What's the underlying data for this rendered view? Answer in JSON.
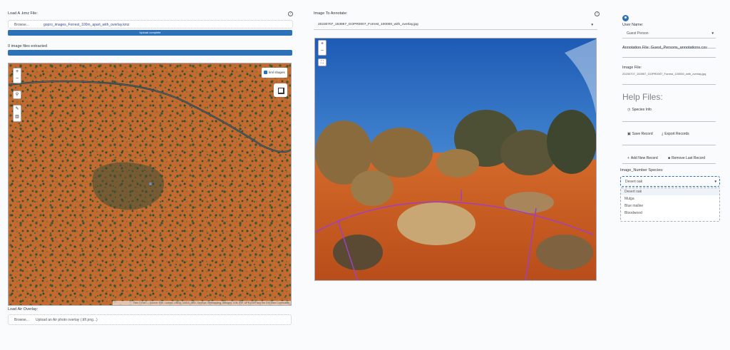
{
  "left": {
    "kmz_label": "Load A .kmz File:",
    "browse": "Browse...",
    "kmz_file": "gopro_images_Forrest_100m_apart_with_overlay.kmz",
    "upload_status": "Upload complete",
    "extracted_label": "0 image files extracted",
    "kml_checkbox_label": "kml shapes",
    "map_attribution": "Tiles © Esri — Source: Esri, i-cubed, USDA, USGS, AEX, GeoEye, Getmapping, Aerogrid, IGN, IGP, UPR-EGP, and the GIS User Community",
    "zoom_in": "+",
    "zoom_out": "−",
    "air_overlay_label": "Load Air Overlay:",
    "air_browse": "Browse...",
    "air_placeholder": "Upload an Air photo overlay (.tif/.png...)"
  },
  "middle": {
    "image_label": "Image To Annotate:",
    "image_file": "20230707_153957_GOPR0007_Forrest_100000_with_overlay.jpg",
    "zoom_in": "+",
    "zoom_out": "−"
  },
  "right": {
    "user_label": "User Name:",
    "user_value": "Guest Person",
    "annotation_file_label": "Annotation File: Guest_Persons_annotations.csv",
    "image_file_label": "Image File:",
    "image_file_value": "20230707_153957_GOPR0007_Forrest_100000_with_overlay.jpg",
    "help_title": "Help Files:",
    "species_link": "Species Info",
    "save_button": "Save Record",
    "export_button": "Export Records",
    "add_button": "Add New Record",
    "remove_button": "Remove Last Record",
    "species_label": "Image_Number Species:",
    "species_placeholder": "Desert oak",
    "species_options": [
      "Desert oak",
      "Mulga",
      "Blue mallee",
      "Bloodwood"
    ]
  },
  "colors": {
    "accent": "#2d71b8",
    "overlay_line": "#a040c0"
  }
}
